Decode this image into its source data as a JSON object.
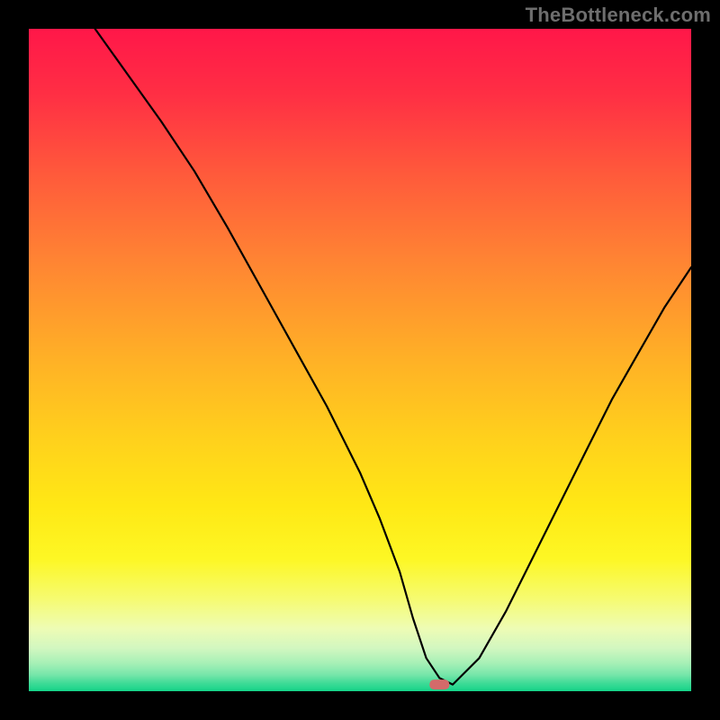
{
  "watermark": "TheBottleneck.com",
  "gradient": {
    "stops": [
      {
        "offset": 0.0,
        "color": "#ff1749"
      },
      {
        "offset": 0.1,
        "color": "#ff2f44"
      },
      {
        "offset": 0.22,
        "color": "#ff5a3b"
      },
      {
        "offset": 0.35,
        "color": "#ff8433"
      },
      {
        "offset": 0.5,
        "color": "#ffb126"
      },
      {
        "offset": 0.62,
        "color": "#ffd11c"
      },
      {
        "offset": 0.72,
        "color": "#ffe815"
      },
      {
        "offset": 0.8,
        "color": "#fdf724"
      },
      {
        "offset": 0.86,
        "color": "#f6fb70"
      },
      {
        "offset": 0.905,
        "color": "#eefcb4"
      },
      {
        "offset": 0.935,
        "color": "#d2f7c0"
      },
      {
        "offset": 0.958,
        "color": "#a6f0b6"
      },
      {
        "offset": 0.975,
        "color": "#77e6aa"
      },
      {
        "offset": 0.988,
        "color": "#3fdb97"
      },
      {
        "offset": 1.0,
        "color": "#14d388"
      }
    ]
  },
  "chart_data": {
    "type": "line",
    "title": "",
    "xlabel": "",
    "ylabel": "",
    "xlim": [
      0,
      100
    ],
    "ylim": [
      0,
      100
    ],
    "grid": false,
    "legend": false,
    "x": [
      10,
      15,
      20,
      25,
      30,
      35,
      40,
      45,
      50,
      53,
      56,
      58,
      60,
      62,
      64,
      68,
      72,
      76,
      80,
      84,
      88,
      92,
      96,
      100
    ],
    "values": [
      100,
      93,
      86,
      78.5,
      70,
      61,
      52,
      43,
      33,
      26,
      18,
      11,
      5,
      2,
      1,
      5,
      12,
      20,
      28,
      36,
      44,
      51,
      58,
      64
    ],
    "marker": {
      "x": 62,
      "y": 1,
      "shape": "pill",
      "color": "#d46a6a"
    }
  }
}
